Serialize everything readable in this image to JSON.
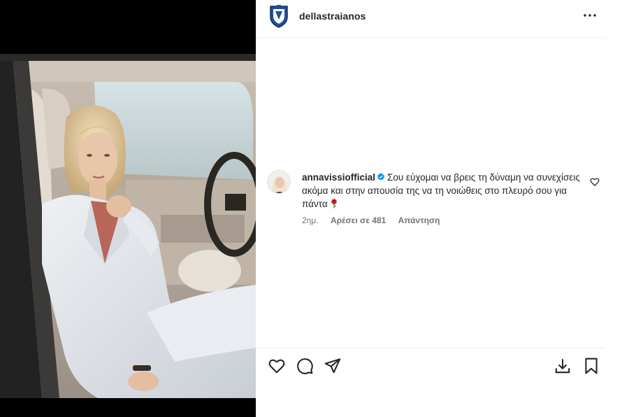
{
  "post": {
    "owner_username": "dellastraianos"
  },
  "comment": {
    "username": "annavissiofficial",
    "text": "Σου εύχομαι να βρεις τη δύναμη να συνεχίσεις ακόμα και στην απουσία της να τη νοιώθεις στο πλευρό σου για πάντα",
    "time": "2ημ.",
    "likes": "Αρέσει σε 481",
    "reply_label": "Απάντηση",
    "emoji": "rose"
  },
  "icons": {
    "more": "more-horizontal-icon",
    "verified": "verified-badge-icon",
    "comment_like": "heart-outline-icon",
    "like": "heart-outline-icon",
    "comment": "comment-bubble-icon",
    "share": "paper-plane-icon",
    "download": "download-icon",
    "save": "bookmark-icon"
  },
  "colors": {
    "verified_blue": "#0095f6",
    "text_primary": "#262626",
    "text_secondary": "#737373",
    "photo_background": "#000000"
  }
}
